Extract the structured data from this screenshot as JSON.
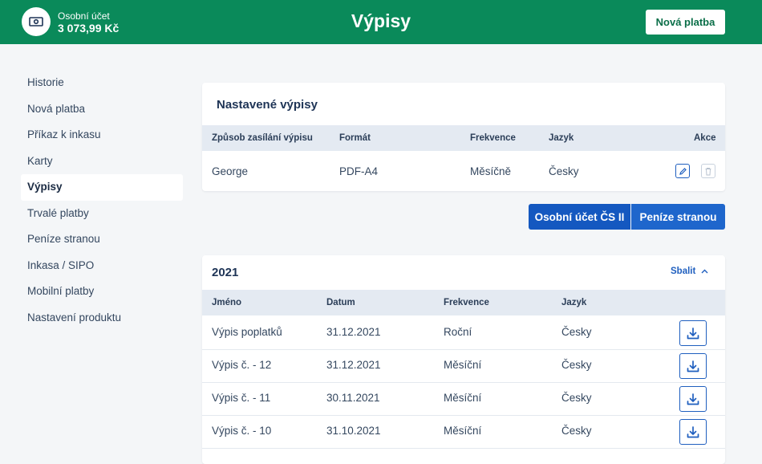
{
  "header": {
    "account_label": "Osobní účet",
    "account_balance": "3 073,99 Kč",
    "title": "Výpisy",
    "new_payment_label": "Nová platba"
  },
  "sidebar": {
    "items": [
      {
        "label": "Historie",
        "active": false
      },
      {
        "label": "Nová platba",
        "active": false
      },
      {
        "label": "Příkaz k inkasu",
        "active": false
      },
      {
        "label": "Karty",
        "active": false
      },
      {
        "label": "Výpisy",
        "active": true
      },
      {
        "label": "Trvalé platby",
        "active": false
      },
      {
        "label": "Peníze stranou",
        "active": false
      },
      {
        "label": "Inkasa / SIPO",
        "active": false
      },
      {
        "label": "Mobilní platby",
        "active": false
      },
      {
        "label": "Nastavení produktu",
        "active": false
      }
    ]
  },
  "settings": {
    "title": "Nastavené výpisy",
    "columns": [
      "Způsob zasílání výpisu",
      "Formát",
      "Frekvence",
      "Jazyk",
      "Akce"
    ],
    "row": {
      "method": "George",
      "format": "PDF-A4",
      "frequency": "Měsíčně",
      "language": "Česky"
    },
    "actions": [
      "edit-icon",
      "trash-icon"
    ]
  },
  "account_switch": {
    "selected": "Osobní účet ČS II",
    "other": "Peníze stranou"
  },
  "year_group": {
    "year": "2021",
    "collapse_label": "Sbalit",
    "columns": [
      "Jméno",
      "Datum",
      "Frekvence",
      "Jazyk"
    ],
    "rows": [
      {
        "name": "Výpis poplatků",
        "date": "31.12.2021",
        "frequency": "Roční",
        "language": "Česky"
      },
      {
        "name": "Výpis č. - 12",
        "date": "31.12.2021",
        "frequency": "Měsíční",
        "language": "Česky"
      },
      {
        "name": "Výpis č. - 11",
        "date": "30.11.2021",
        "frequency": "Měsíční",
        "language": "Česky"
      },
      {
        "name": "Výpis č. - 10",
        "date": "31.10.2021",
        "frequency": "Měsíční",
        "language": "Česky"
      }
    ],
    "download_icon": "download-icon"
  },
  "colors": {
    "header_green": "#0a8a5a",
    "accent_blue": "#1458c0",
    "table_header_bg": "#e4eaf2"
  }
}
